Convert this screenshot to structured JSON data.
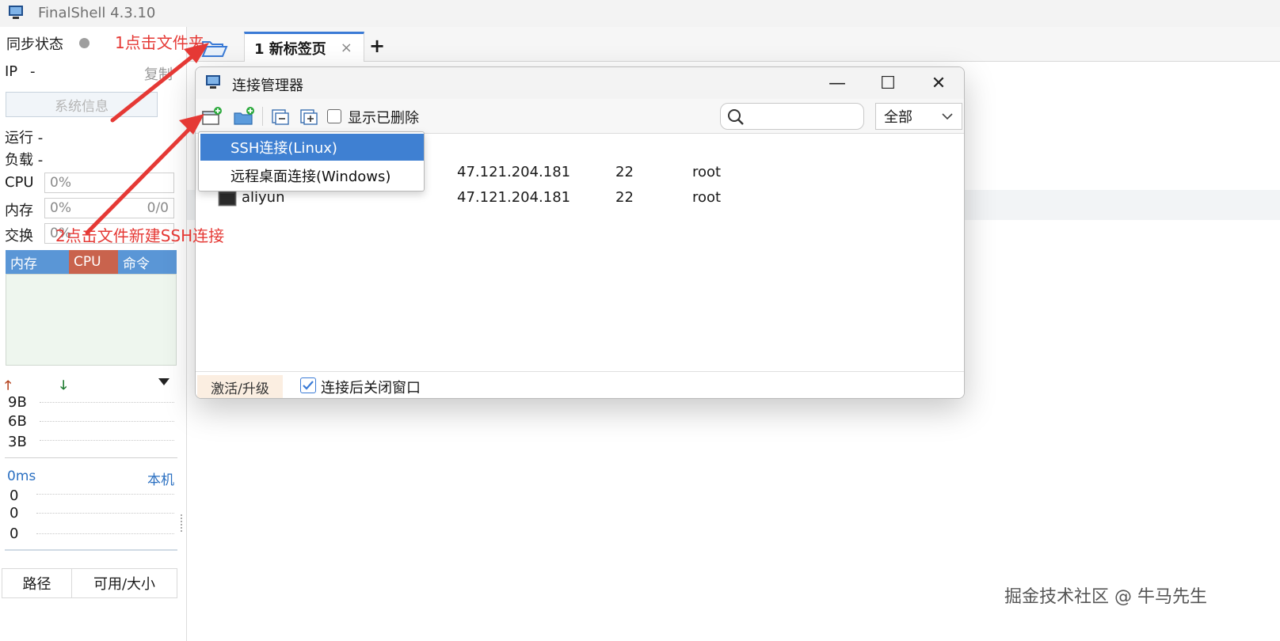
{
  "app": {
    "title": "FinalShell 4.3.10"
  },
  "sidebar": {
    "sync_label": "同步状态",
    "ip_label": "IP",
    "ip_value": "-",
    "copy_label": "复制",
    "sysinfo_button": "系统信息",
    "running_label": "运行 -",
    "load_label": "负载 -",
    "cpu_label": "CPU",
    "cpu_value": "0%",
    "mem_label": "内存",
    "mem_value": "0%",
    "mem_extra": "0/0",
    "swap_label": "交换",
    "swap_value": "0%",
    "tabs": [
      "内存",
      "CPU",
      "命令"
    ],
    "net_values": [
      "9B",
      "6B",
      "3B"
    ],
    "latency": "0ms",
    "latency_host": "本机",
    "ping_values": [
      "0",
      "0",
      "0"
    ],
    "disk_headers": [
      "路径",
      "可用/大小"
    ]
  },
  "tabbar": {
    "active_tab": "1 新标签页",
    "close_glyph": "×",
    "new_tab": "+"
  },
  "dialog": {
    "title": "连接管理器",
    "window_controls": {
      "minimize": "—",
      "maximize": "☐",
      "close": "✕"
    },
    "show_deleted_label": "显示已删除",
    "search_placeholder": "",
    "filter_value": "全部",
    "rows": [
      {
        "name": "",
        "host": "47.121.204.181",
        "port": "22",
        "user": "root"
      },
      {
        "name": "aliyun",
        "host": "47.121.204.181",
        "port": "22",
        "user": "root"
      }
    ],
    "footer": {
      "activate": "激活/升级",
      "close_after_connect": "连接后关闭窗口",
      "close_after_checked": true
    }
  },
  "menu": {
    "items": [
      "SSH连接(Linux)",
      "远程桌面连接(Windows)"
    ]
  },
  "annotations": {
    "step1": "1点击文件夹",
    "step2": "2点击文件新建SSH连接"
  },
  "watermark": "掘金技术社区 @ 牛马先生",
  "colors": {
    "accent": "#3f80d2",
    "annotation": "#e53935",
    "cpu_tab": "#c9634d",
    "mem_tab": "#5a96d6"
  }
}
